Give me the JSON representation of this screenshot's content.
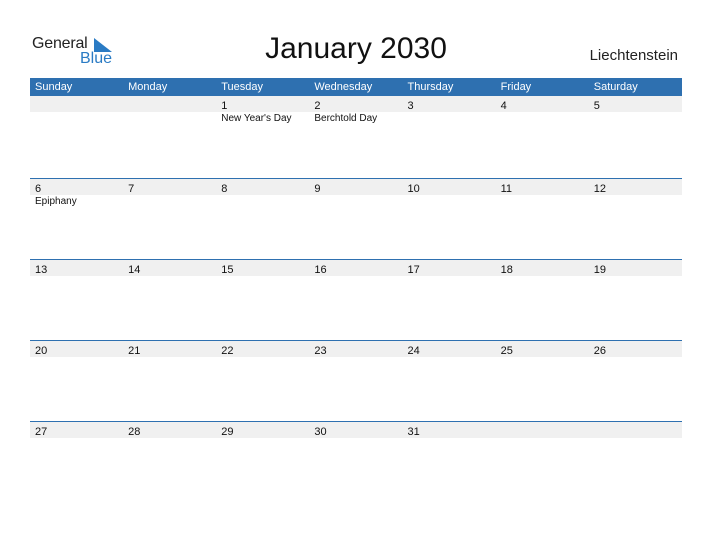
{
  "logo": {
    "general": "General",
    "blue": "Blue",
    "accent_color": "#2a7bc4"
  },
  "title": "January 2030",
  "country": "Liechtenstein",
  "colors": {
    "header_bg": "#2e70b0",
    "date_strip_bg": "#f0f0f0"
  },
  "weekdays": [
    "Sunday",
    "Monday",
    "Tuesday",
    "Wednesday",
    "Thursday",
    "Friday",
    "Saturday"
  ],
  "weeks": [
    {
      "days": [
        "",
        "",
        "1",
        "2",
        "3",
        "4",
        "5"
      ],
      "events": [
        "",
        "",
        "New Year's Day",
        "Berchtold Day",
        "",
        "",
        ""
      ]
    },
    {
      "days": [
        "6",
        "7",
        "8",
        "9",
        "10",
        "11",
        "12"
      ],
      "events": [
        "Epiphany",
        "",
        "",
        "",
        "",
        "",
        ""
      ]
    },
    {
      "days": [
        "13",
        "14",
        "15",
        "16",
        "17",
        "18",
        "19"
      ],
      "events": [
        "",
        "",
        "",
        "",
        "",
        "",
        ""
      ]
    },
    {
      "days": [
        "20",
        "21",
        "22",
        "23",
        "24",
        "25",
        "26"
      ],
      "events": [
        "",
        "",
        "",
        "",
        "",
        "",
        ""
      ]
    },
    {
      "days": [
        "27",
        "28",
        "29",
        "30",
        "31",
        "",
        ""
      ],
      "events": [
        "",
        "",
        "",
        "",
        "",
        "",
        ""
      ]
    }
  ]
}
